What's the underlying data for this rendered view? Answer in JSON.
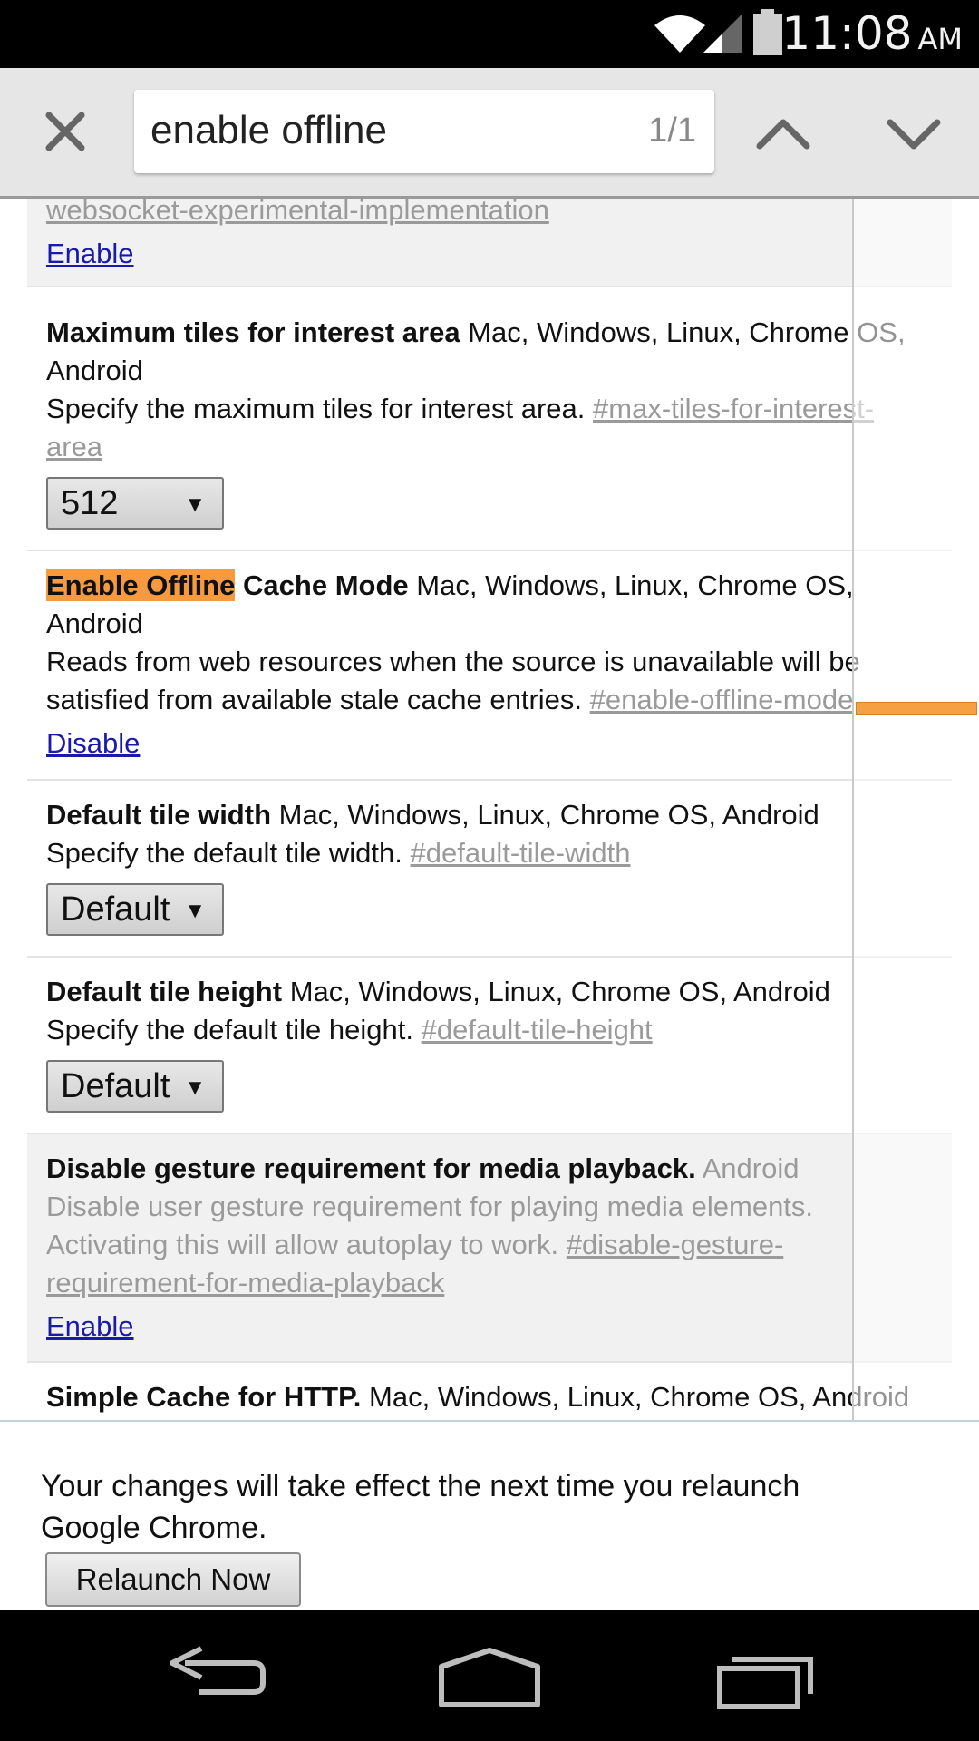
{
  "status_bar": {
    "time": "11:08",
    "ampm": "AM",
    "icons": [
      "wifi-icon",
      "cell-signal-icon",
      "battery-icon"
    ]
  },
  "find_bar": {
    "query": "enable offline",
    "count": "1/1",
    "icons": [
      "close-icon",
      "chevron-up-icon",
      "chevron-down-icon"
    ]
  },
  "experiments": [
    {
      "anchor": "websocket-experimental-implementation",
      "action": "Enable"
    },
    {
      "name": "Maximum tiles for interest area",
      "platforms_line1": "Mac, Windows, Linux, Chrome OS,",
      "platforms_line2": "Android",
      "description": "Specify the maximum tiles for interest area.",
      "anchor_line1": "#max-tiles-for-interest-",
      "anchor_line2": "area",
      "select_value": "512"
    },
    {
      "name_highlight": "Enable Offline",
      "name_rest": "Cache Mode",
      "platforms_line1": "Mac, Windows, Linux, Chrome OS,",
      "platforms_line2": "Android",
      "description_line1": "Reads from web resources when the source is unavailable will be",
      "description_line2": "satisfied from available stale cache entries.",
      "anchor": "#enable-offline-mode",
      "action": "Disable"
    },
    {
      "name": "Default tile width",
      "platforms": "Mac, Windows, Linux, Chrome OS, Android",
      "description": "Specify the default tile width.",
      "anchor": "#default-tile-width",
      "select_value": "Default"
    },
    {
      "name": "Default tile height",
      "platforms": "Mac, Windows, Linux, Chrome OS, Android",
      "description": "Specify the default tile height.",
      "anchor": "#default-tile-height",
      "select_value": "Default"
    },
    {
      "name": "Disable gesture requirement for media playback.",
      "platforms": "Android",
      "description_line1": "Disable user gesture requirement for playing media elements.",
      "description_line2": "Activating this will allow autoplay to work.",
      "anchor_line1": "#disable-gesture-",
      "anchor_line2": "requirement-for-media-playback",
      "action": "Enable"
    },
    {
      "name": "Simple Cache for HTTP.",
      "platforms": "Mac, Windows, Linux, Chrome OS, Android"
    }
  ],
  "relaunch": {
    "message": "Your changes will take effect the next time you relaunch Google Chrome.",
    "button_label": "Relaunch Now"
  },
  "nav_bar": {
    "icons": [
      "back-icon",
      "home-icon",
      "recents-icon"
    ]
  },
  "colors": {
    "find_highlight": "#f59a3f",
    "link": "#1a1aaa",
    "status_bar": "#000000",
    "find_bar_bg": "#e6e6e6"
  }
}
